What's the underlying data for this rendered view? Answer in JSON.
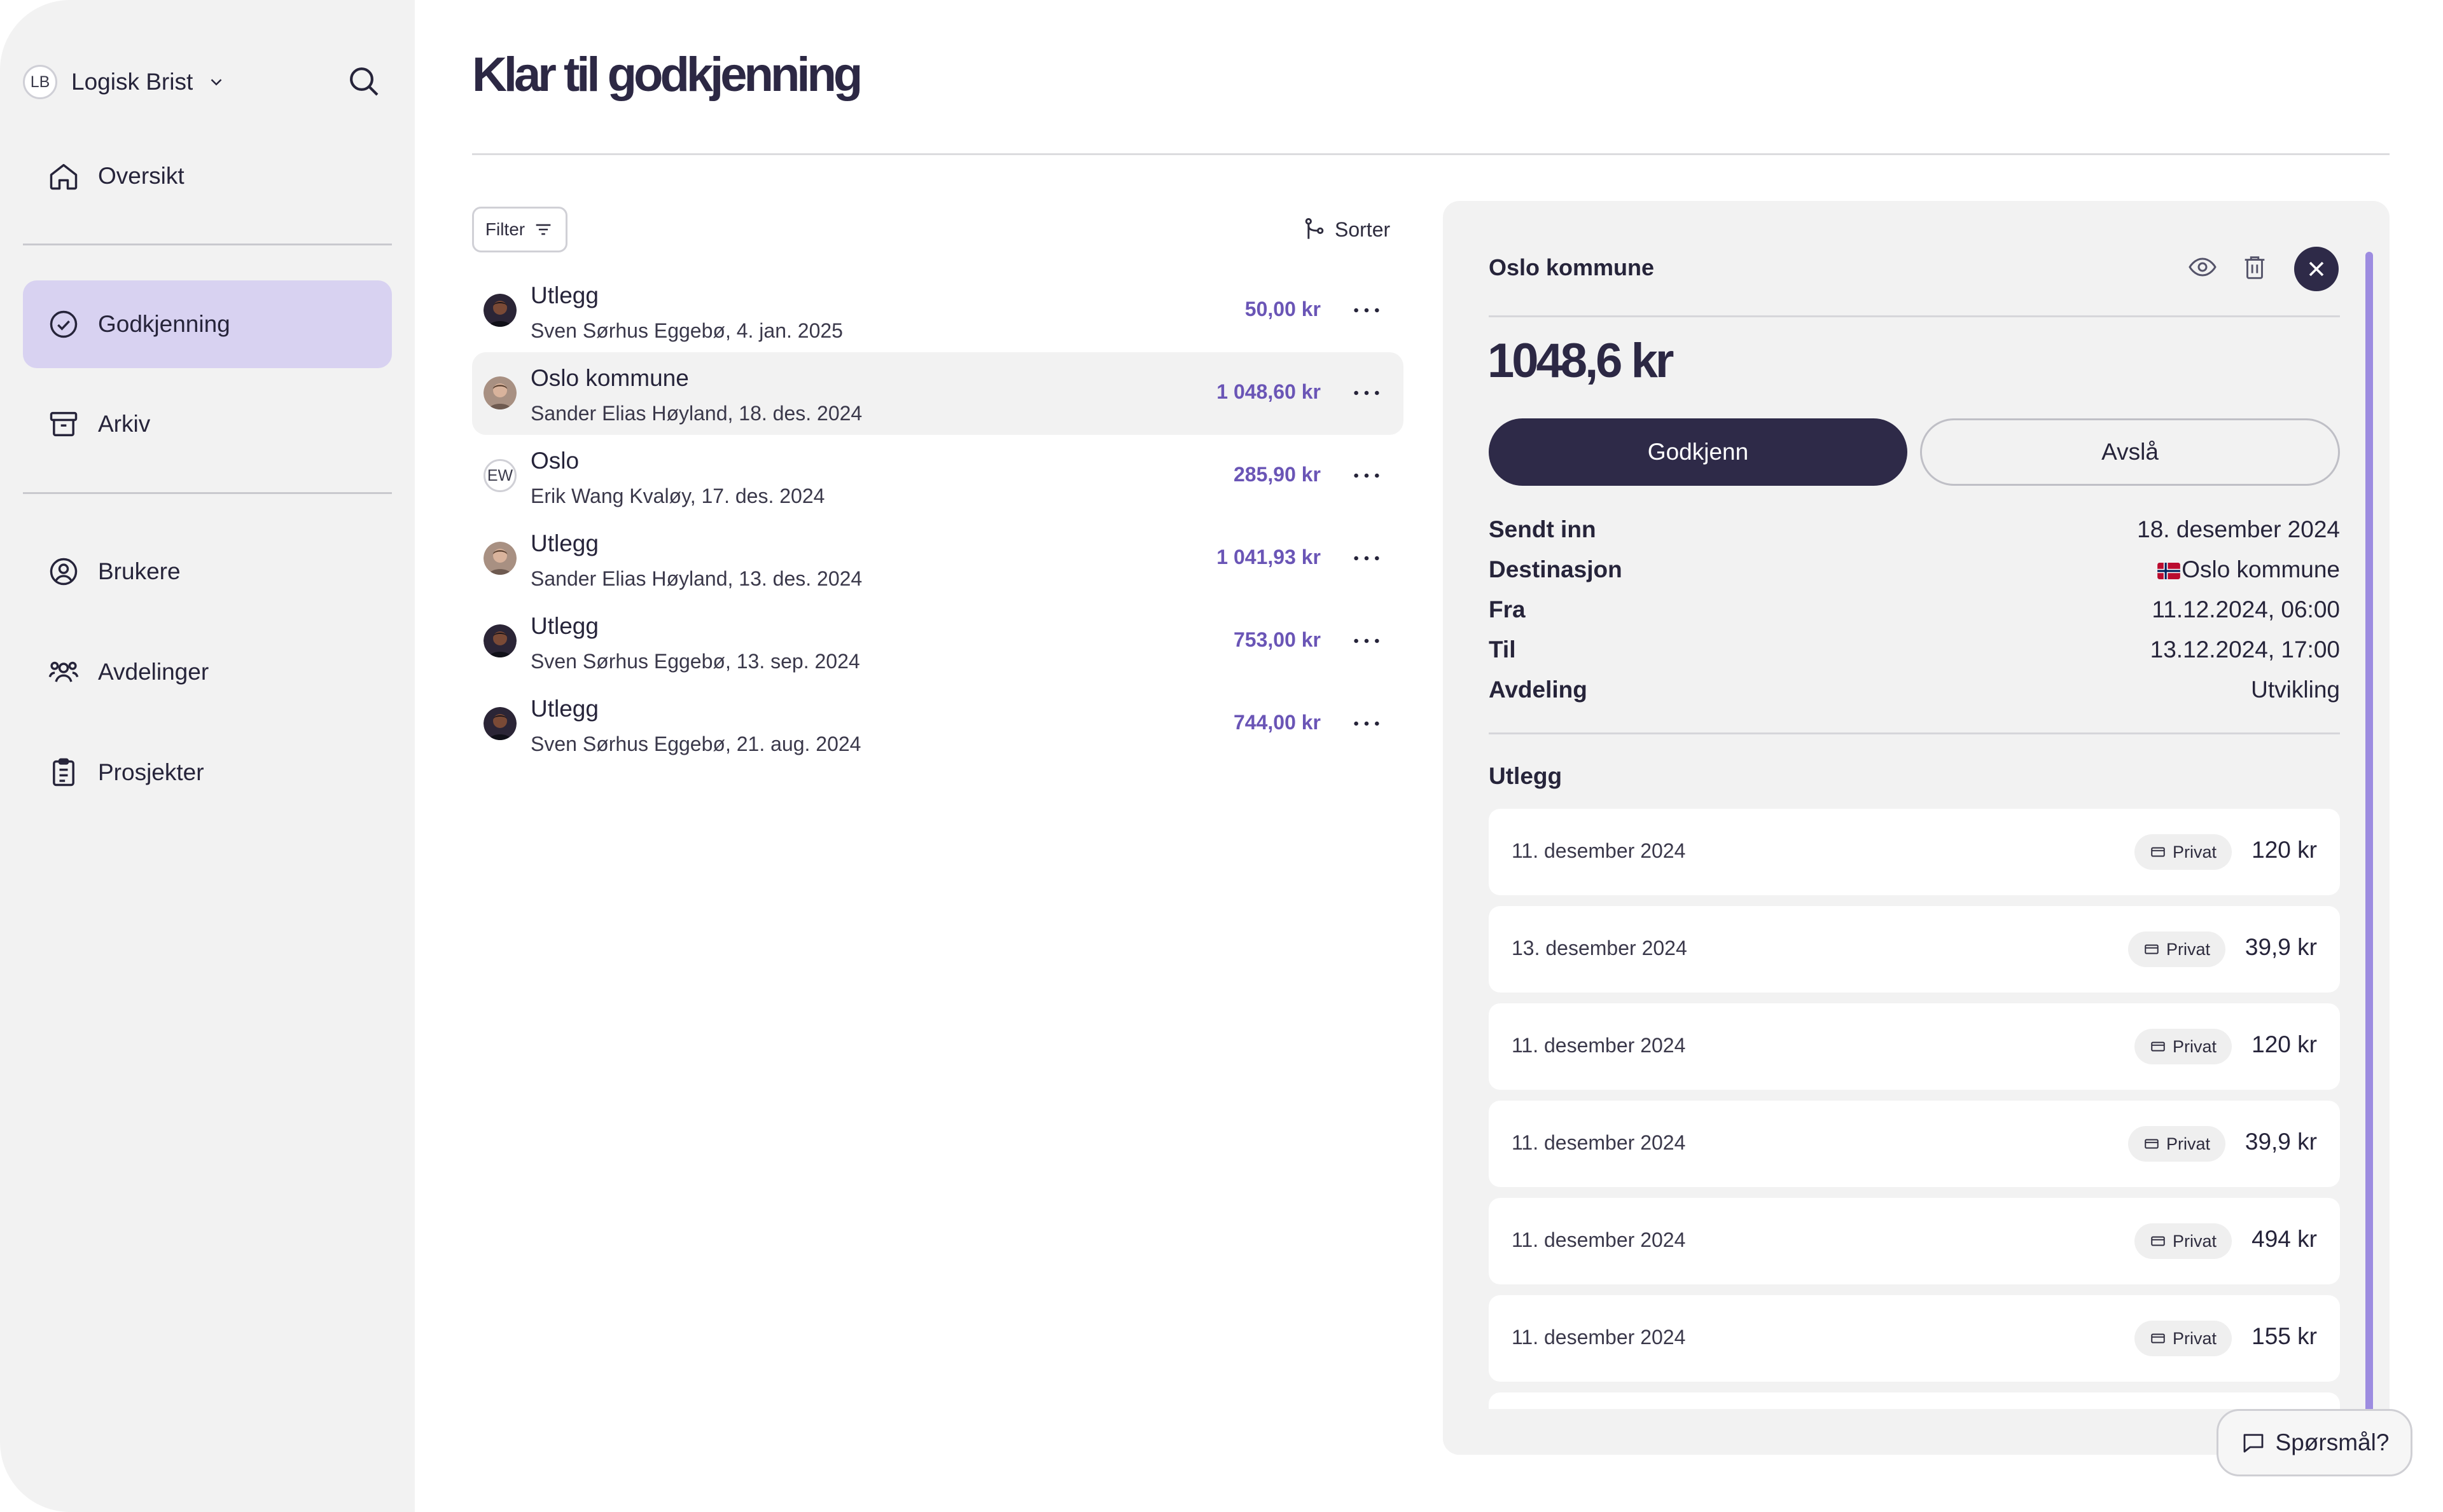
{
  "sidebar": {
    "org": {
      "initials": "LB",
      "name": "Logisk Brist"
    },
    "nav": [
      {
        "label": "Oversikt",
        "icon": "home-icon"
      },
      {
        "label": "Godkjenning",
        "icon": "check-circle-icon",
        "active": true
      },
      {
        "label": "Arkiv",
        "icon": "archive-icon"
      },
      {
        "label": "Brukere",
        "icon": "user-circle-icon"
      },
      {
        "label": "Avdelinger",
        "icon": "users-icon"
      },
      {
        "label": "Prosjekter",
        "icon": "clipboard-icon"
      }
    ]
  },
  "main": {
    "title": "Klar til godkjenning",
    "filter_label": "Filter",
    "sort_label": "Sorter",
    "rows": [
      {
        "title": "Utlegg",
        "subtitle": "Sven Sørhus Eggebø, 4. jan. 2025",
        "amount": "50,00 kr",
        "avatar": "photo-dark"
      },
      {
        "title": "Oslo kommune",
        "subtitle": "Sander Elias Høyland, 18. des. 2024",
        "amount": "1 048,60 kr",
        "avatar": "photo-light",
        "selected": true
      },
      {
        "title": "Oslo",
        "subtitle": "Erik Wang Kvaløy, 17. des. 2024",
        "amount": "285,90 kr",
        "avatar": "initials",
        "initials": "EW"
      },
      {
        "title": "Utlegg",
        "subtitle": "Sander Elias Høyland, 13. des. 2024",
        "amount": "1 041,93 kr",
        "avatar": "photo-light"
      },
      {
        "title": "Utlegg",
        "subtitle": "Sven Sørhus Eggebø, 13. sep. 2024",
        "amount": "753,00 kr",
        "avatar": "photo-dark"
      },
      {
        "title": "Utlegg",
        "subtitle": "Sven Sørhus Eggebø, 21. aug. 2024",
        "amount": "744,00 kr",
        "avatar": "photo-dark"
      }
    ]
  },
  "detail": {
    "title": "Oslo kommune",
    "amount": "1048,6 kr",
    "approve_label": "Godkjenn",
    "reject_label": "Avslå",
    "info": [
      {
        "label": "Sendt inn",
        "value": "18. desember 2024"
      },
      {
        "label": "Destinasjon",
        "value": "Oslo kommune",
        "flag": "norway-flag"
      },
      {
        "label": "Fra",
        "value": "11.12.2024, 06:00"
      },
      {
        "label": "Til",
        "value": "13.12.2024, 17:00"
      },
      {
        "label": "Avdeling",
        "value": "Utvikling"
      }
    ],
    "section_title": "Utlegg",
    "expenses": [
      {
        "date": "11. desember 2024",
        "badge": "Privat",
        "amount": "120 kr"
      },
      {
        "date": "13. desember 2024",
        "badge": "Privat",
        "amount": "39,9 kr"
      },
      {
        "date": "11. desember 2024",
        "badge": "Privat",
        "amount": "120 kr"
      },
      {
        "date": "11. desember 2024",
        "badge": "Privat",
        "amount": "39,9 kr"
      },
      {
        "date": "11. desember 2024",
        "badge": "Privat",
        "amount": "494 kr"
      },
      {
        "date": "11. desember 2024",
        "badge": "Privat",
        "amount": "155 kr"
      }
    ]
  },
  "help_label": "Spørsmål?",
  "colors": {
    "accent": "#6a55b6",
    "dark": "#2e2a48",
    "active_nav": "#d8d2f1",
    "scrollbar": "#9d8ce0"
  }
}
